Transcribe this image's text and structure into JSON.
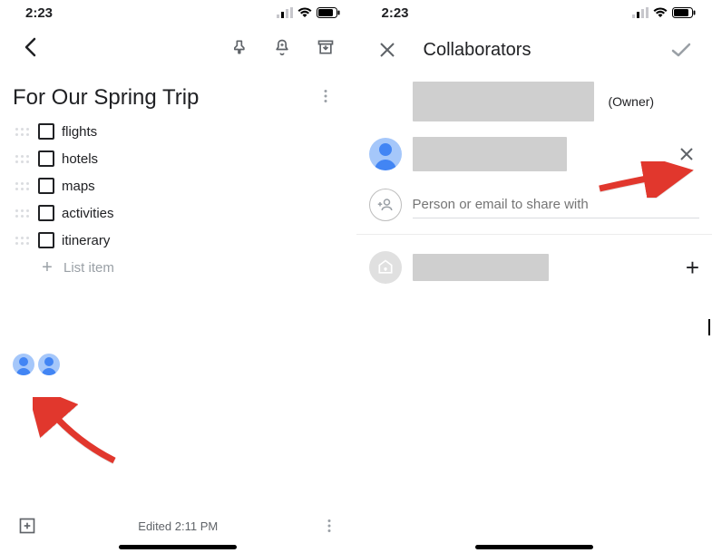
{
  "status": {
    "time": "2:23"
  },
  "note": {
    "title": "For Our Spring Trip",
    "items": [
      "flights",
      "hotels",
      "maps",
      "activities",
      "itinerary"
    ],
    "new_item_placeholder": "List item",
    "edited_label": "Edited 2:11 PM"
  },
  "collaborators": {
    "heading": "Collaborators",
    "owner_label": "(Owner)",
    "add_placeholder": "Person or email to share with"
  }
}
